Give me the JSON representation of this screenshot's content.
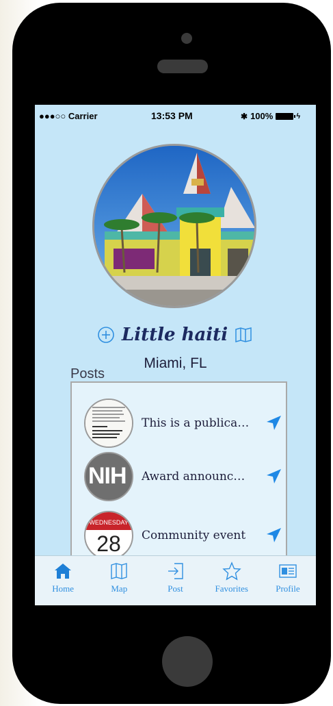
{
  "status_bar": {
    "carrier": "●●●○○ Carrier",
    "time": "13:53 PM",
    "battery": "100%"
  },
  "place": {
    "name": "Little haiti",
    "location": "Miami, FL"
  },
  "posts": {
    "label": "Posts",
    "items": [
      {
        "text": "This is a publica…",
        "thumb": "document-icon"
      },
      {
        "text": "Award announc…",
        "thumb": "nih-logo",
        "thumb_text": "NIH"
      },
      {
        "text": "Community event",
        "thumb": "calendar-icon",
        "thumb_day": "WEDNESDAY",
        "thumb_date": "28"
      }
    ]
  },
  "tabs": [
    {
      "label": "Home",
      "icon": "home-icon"
    },
    {
      "label": "Map",
      "icon": "map-icon"
    },
    {
      "label": "Post",
      "icon": "post-icon"
    },
    {
      "label": "Favorites",
      "icon": "star-icon"
    },
    {
      "label": "Profile",
      "icon": "profile-card-icon"
    }
  ],
  "colors": {
    "screen_bg": "#c5e6f8",
    "accent": "#2f8fe0",
    "title": "#1c2a60"
  }
}
